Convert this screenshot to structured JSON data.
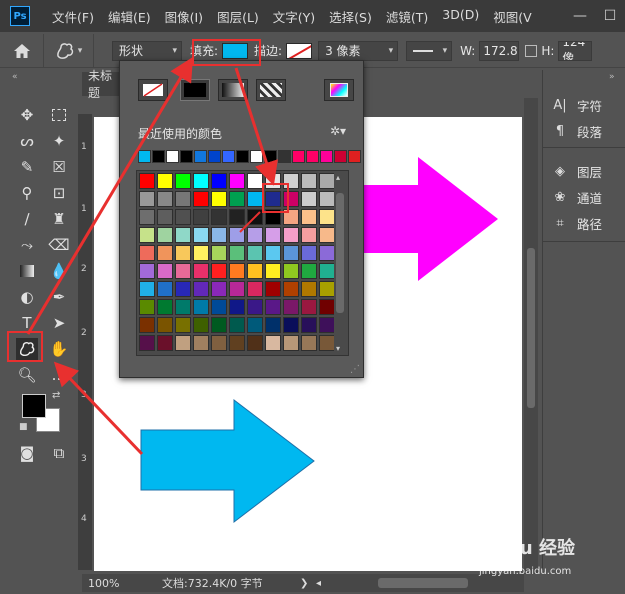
{
  "app": {
    "logo_text": "Ps",
    "menu": [
      "文件(F)",
      "编辑(E)",
      "图像(I)",
      "图层(L)",
      "文字(Y)",
      "选择(S)",
      "滤镜(T)",
      "3D(D)",
      "视图(V"
    ],
    "window_controls": [
      "—",
      "☐"
    ]
  },
  "options": {
    "mode_value": "形状",
    "fill_label": "填充:",
    "fill_color": "#00b8f0",
    "stroke_label": "描边:",
    "stroke_width": "3 像素",
    "w_label": "W:",
    "w_value": "172.88",
    "h_label": "H:",
    "h_value": "124 像"
  },
  "document": {
    "tab_title": "未标题",
    "zoom": "100%",
    "doc_info": "文档:732.4K/0 字节",
    "ruler_ticks": [
      "1",
      "1",
      "2",
      "2",
      "3",
      "3",
      "4"
    ]
  },
  "swatch_popup": {
    "recent_title": "最近使用的颜色",
    "recent_colors": [
      "#00b8f0",
      "#000000",
      "#ffffff",
      "#000000",
      "#1177dd",
      "#0044cc",
      "#3366ff",
      "#000000",
      "#ffffff",
      "#000000",
      "#333333",
      "#ff0066",
      "#ff0066",
      "#ff0099",
      "#cc0033",
      "#e02020"
    ],
    "grid_rows": [
      [
        "#ff0000",
        "#ffff00",
        "#00ff00",
        "#00ffff",
        "#0000ff",
        "#ff00ff",
        "#ffffff",
        "#e6e6e6",
        "#d0d0d0",
        "#bbbbbb",
        "#aaaaaa"
      ],
      [
        "#999999",
        "#888888",
        "#777777",
        "#ff0000",
        "#ffff00",
        "#00a050",
        "#00b8f0",
        "#1f2b8f",
        "#cc0066",
        "#cccccc",
        "#bbbbbb"
      ],
      [
        "#6e6e6e",
        "#5e5e5e",
        "#505050",
        "#404040",
        "#333333",
        "#222222",
        "#111111",
        "#000000",
        "#f4a582",
        "#fbc08a",
        "#fde38a"
      ],
      [
        "#c6e28a",
        "#9fd3a0",
        "#8fd8c8",
        "#8ad8f0",
        "#8ab8e8",
        "#9e9ee8",
        "#b69ee8",
        "#d69ee8",
        "#f49ec8",
        "#f49ea0",
        "#f7b98a"
      ],
      [
        "#ee6b5b",
        "#f0945b",
        "#f8c85b",
        "#fff060",
        "#a7d45b",
        "#5bbf7a",
        "#5bc4b0",
        "#5bc8f0",
        "#5b95d8",
        "#6a6ad8",
        "#8b6ad8"
      ],
      [
        "#a26ad8",
        "#d86ac8",
        "#e86a98",
        "#e8306a",
        "#ff2020",
        "#ff7a20",
        "#ffc020",
        "#ffee20",
        "#8fc820",
        "#20a840",
        "#20b090"
      ],
      [
        "#20b0e8",
        "#2070c8",
        "#2828b8",
        "#6228b8",
        "#8a28b8",
        "#b82898",
        "#d82860",
        "#a00000",
        "#b04000",
        "#b07800",
        "#a8a000"
      ],
      [
        "#5a8a00",
        "#007a30",
        "#007a6a",
        "#007aa8",
        "#004a98",
        "#101888",
        "#3a1888",
        "#5a1888",
        "#7a1868",
        "#9a1840",
        "#700000"
      ],
      [
        "#7a3000",
        "#7a5400",
        "#787000",
        "#3e6000",
        "#005a20",
        "#005a4e",
        "#005a7a",
        "#00306a",
        "#0a0e5a",
        "#28105a",
        "#3e105a"
      ],
      [
        "#56104a",
        "#6a102a",
        "#c0a080",
        "#a08060",
        "#806040",
        "#604020",
        "#503018",
        "#d8b8a0",
        "#b89878",
        "#987858",
        "#785838"
      ]
    ]
  },
  "right_panel": {
    "group1": [
      {
        "icon": "character-icon",
        "label": "字符"
      },
      {
        "icon": "paragraph-icon",
        "label": "段落"
      }
    ],
    "group2": [
      {
        "icon": "layers-icon",
        "label": "图层"
      },
      {
        "icon": "channels-icon",
        "label": "通道"
      },
      {
        "icon": "paths-icon",
        "label": "路径"
      }
    ]
  },
  "shapes": {
    "arrow_magenta_color": "#ff00ff",
    "arrow_cyan_color": "#00b8f0"
  },
  "watermark": {
    "text": "Baidu 经验",
    "sub": "jingyan.baidu.com"
  }
}
